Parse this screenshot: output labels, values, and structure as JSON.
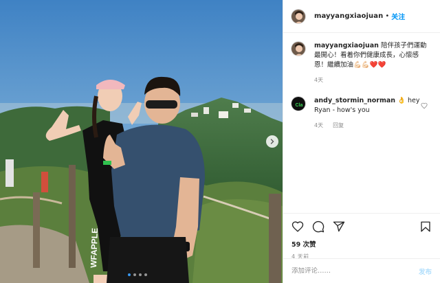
{
  "post": {
    "username": "mayyangxiaojuan",
    "separator": "•",
    "follow_label": "关注"
  },
  "caption": {
    "username": "mayyangxiaojuan",
    "text": "陪伴孩子們運動最開心！看着你們健康成長，心懷感恩！繼續加油💪🏻💪🏻❤️❤️",
    "time": "4天"
  },
  "comment": {
    "username": "andy_stormin_norman",
    "text": "hey Ryan - how's you",
    "emoji": "👌",
    "time": "4天",
    "reply_label": "回复"
  },
  "actions": {
    "like_icon": "heart-icon",
    "comment_icon": "comment-icon",
    "share_icon": "share-icon",
    "save_icon": "bookmark-icon"
  },
  "likes": "59 次赞",
  "timestamp": "4 天前",
  "add_comment": {
    "placeholder": "添加评论……",
    "post_label": "发布"
  },
  "carousel": {
    "total": 4,
    "active": 1,
    "shirt_text": "WFAPPLE"
  },
  "colors": {
    "accent": "#0095f6",
    "post_disabled": "#b2dffc",
    "muted": "#8e8e8e"
  }
}
